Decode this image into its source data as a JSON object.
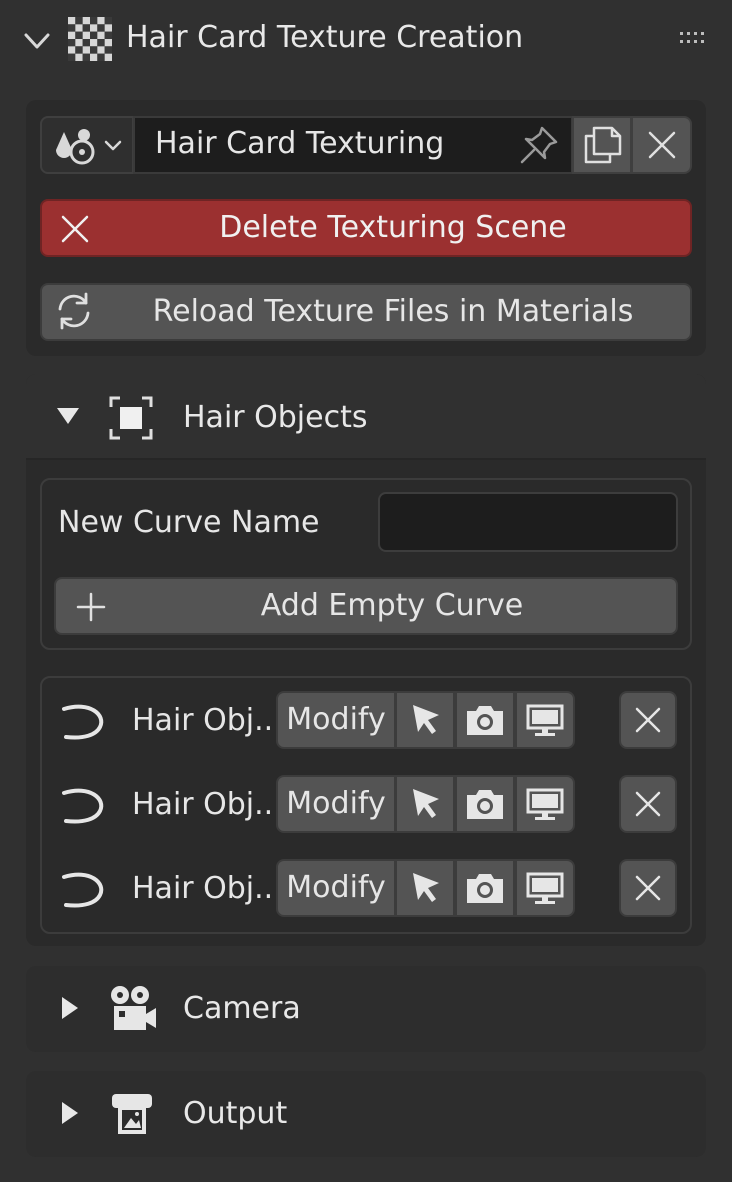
{
  "panel": {
    "title": "Hair Card Texture Creation",
    "icons": {
      "collapse": "chevron-down-icon",
      "checker": "checkerboard-icon",
      "grip": "drag-grip-icon"
    }
  },
  "scene": {
    "name": "Hair Card Texturing",
    "icons": {
      "type": "scene-type-icon",
      "pin": "pin-icon",
      "copy": "duplicate-icon",
      "unlink": "close-icon"
    },
    "delete_label": "Delete Texturing Scene",
    "reload_label": "Reload Texture Files in Materials"
  },
  "colors": {
    "danger": "#9b3030",
    "button": "#545454",
    "panel": "#2a2a2a",
    "background": "#303030"
  },
  "hair_objects": {
    "title": "Hair Objects",
    "new_curve_label": "New Curve Name",
    "new_curve_value": "",
    "add_curve_label": "Add Empty Curve",
    "items": [
      {
        "name": "Hair Obj...",
        "modify_label": "Modify"
      },
      {
        "name": "Hair Obj...",
        "modify_label": "Modify"
      },
      {
        "name": "Hair Obj...",
        "modify_label": "Modify"
      }
    ]
  },
  "camera": {
    "title": "Camera"
  },
  "output": {
    "title": "Output"
  }
}
